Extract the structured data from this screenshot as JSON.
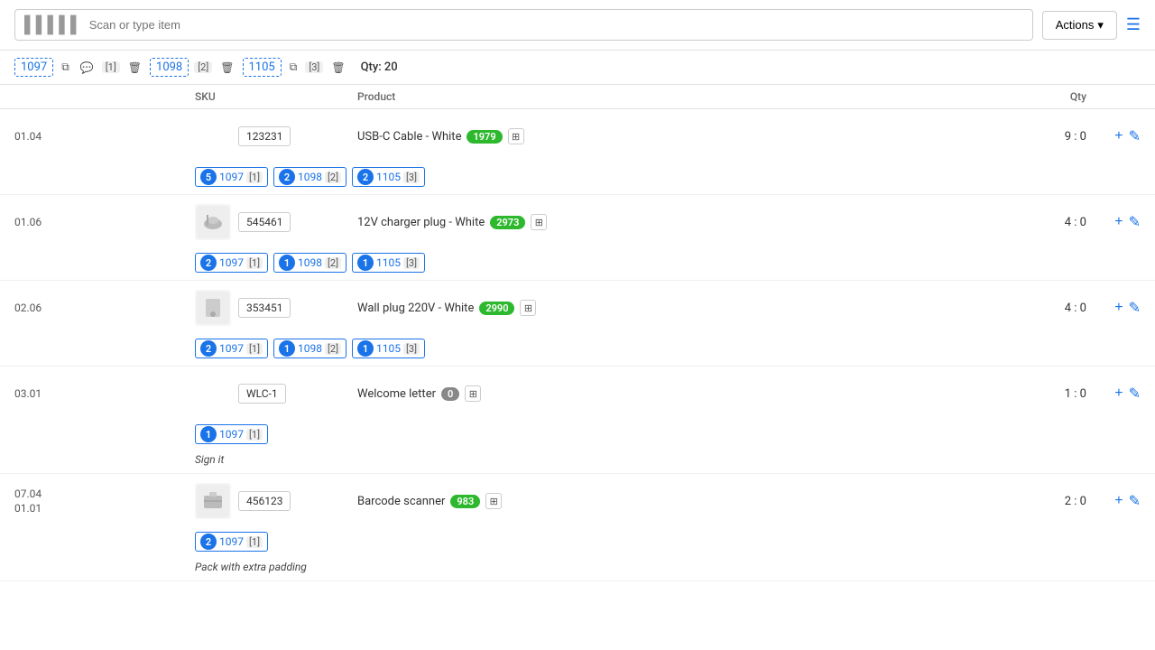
{
  "header": {
    "scan_placeholder": "Scan or type item",
    "actions_label": "Actions",
    "qty_label": "Qty: 20"
  },
  "orders": [
    {
      "id": "1097",
      "count": 1,
      "has_image": false,
      "has_comment": true
    },
    {
      "id": "1098",
      "count": 2,
      "has_image": true,
      "has_comment": false
    },
    {
      "id": "1105",
      "count": 3,
      "has_image": true,
      "has_comment": false
    }
  ],
  "columns": {
    "sku": "SKU",
    "product": "Product",
    "qty": "Qty"
  },
  "products": [
    {
      "location": "01.04",
      "has_image": false,
      "sku": "123231",
      "name": "USB-C Cable - White",
      "badge": "1979",
      "badge_type": "green",
      "qty": "9 : 0",
      "tags": [
        {
          "count": 5,
          "order_id": "1097",
          "qty": 1
        },
        {
          "count": 2,
          "order_id": "1098",
          "qty": 2
        },
        {
          "count": 2,
          "order_id": "1105",
          "qty": 3
        }
      ],
      "note": ""
    },
    {
      "location": "01.06",
      "has_image": true,
      "sku": "545461",
      "name": "12V charger plug - White",
      "badge": "2973",
      "badge_type": "green",
      "qty": "4 : 0",
      "tags": [
        {
          "count": 2,
          "order_id": "1097",
          "qty": 1
        },
        {
          "count": 1,
          "order_id": "1098",
          "qty": 2
        },
        {
          "count": 1,
          "order_id": "1105",
          "qty": 3
        }
      ],
      "note": ""
    },
    {
      "location": "02.06",
      "has_image": true,
      "sku": "353451",
      "name": "Wall plug 220V - White",
      "badge": "2990",
      "badge_type": "green",
      "qty": "4 : 0",
      "tags": [
        {
          "count": 2,
          "order_id": "1097",
          "qty": 1
        },
        {
          "count": 1,
          "order_id": "1098",
          "qty": 2
        },
        {
          "count": 1,
          "order_id": "1105",
          "qty": 3
        }
      ],
      "note": ""
    },
    {
      "location": "03.01",
      "has_image": false,
      "sku": "WLC-1",
      "name": "Welcome letter",
      "badge": "0",
      "badge_type": "zero",
      "qty": "1 : 0",
      "tags": [
        {
          "count": 1,
          "order_id": "1097",
          "qty": 1
        }
      ],
      "note": "Sign it"
    },
    {
      "location": "07.04\n01.01",
      "has_image": true,
      "sku": "456123",
      "name": "Barcode scanner",
      "badge": "983",
      "badge_type": "green",
      "qty": "2 : 0",
      "tags": [
        {
          "count": 2,
          "order_id": "1097",
          "qty": 1
        }
      ],
      "note": "Pack with extra padding"
    }
  ],
  "icons": {
    "barcode": "▌▌▌▌▌",
    "chevron_down": "▾",
    "menu": "≡",
    "plus": "+",
    "edit": "✎",
    "copy": "⧉",
    "comment": "💬",
    "trash": "🗑",
    "expand": "⊞"
  }
}
